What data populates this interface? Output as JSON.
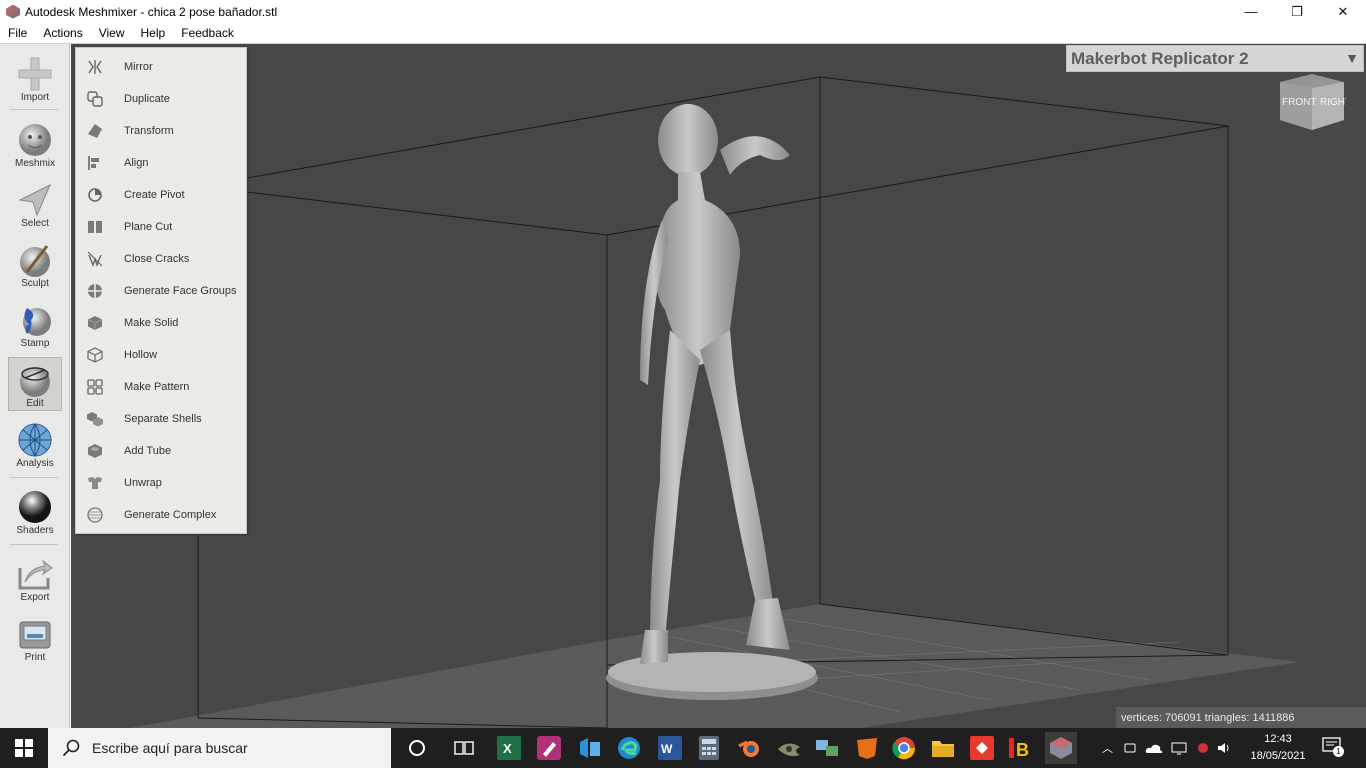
{
  "window": {
    "title": "Autodesk Meshmixer - chica 2 pose bañador.stl",
    "minimize": "—",
    "maximize": "❐",
    "close": "✕"
  },
  "menu": [
    "File",
    "Actions",
    "View",
    "Help",
    "Feedback"
  ],
  "toolbar": [
    {
      "label": "Import",
      "icon": "plus-icon"
    },
    {
      "label": "Meshmix",
      "icon": "face-sphere-icon"
    },
    {
      "label": "Select",
      "icon": "arrow-pointer-icon"
    },
    {
      "label": "Sculpt",
      "icon": "brush-sphere-icon"
    },
    {
      "label": "Stamp",
      "icon": "stamp-sphere-icon"
    },
    {
      "label": "Edit",
      "icon": "edit-sphere-icon"
    },
    {
      "label": "Analysis",
      "icon": "mesh-sphere-icon"
    },
    {
      "label": "Shaders",
      "icon": "chrome-sphere-icon"
    },
    {
      "label": "Export",
      "icon": "export-tray-icon"
    },
    {
      "label": "Print",
      "icon": "printer-icon"
    }
  ],
  "edit_menu": [
    {
      "label": "Mirror",
      "icon": "mirror-icon"
    },
    {
      "label": "Duplicate",
      "icon": "duplicate-icon"
    },
    {
      "label": "Transform",
      "icon": "transform-icon"
    },
    {
      "label": "Align",
      "icon": "align-icon"
    },
    {
      "label": "Create Pivot",
      "icon": "pivot-icon"
    },
    {
      "label": "Plane Cut",
      "icon": "plane-cut-icon"
    },
    {
      "label": "Close Cracks",
      "icon": "close-cracks-icon"
    },
    {
      "label": "Generate Face Groups",
      "icon": "face-groups-icon"
    },
    {
      "label": "Make Solid",
      "icon": "solid-cube-icon"
    },
    {
      "label": "Hollow",
      "icon": "hollow-cube-icon"
    },
    {
      "label": "Make Pattern",
      "icon": "pattern-icon"
    },
    {
      "label": "Separate Shells",
      "icon": "separate-shells-icon"
    },
    {
      "label": "Add Tube",
      "icon": "tube-icon"
    },
    {
      "label": "Unwrap",
      "icon": "unwrap-icon"
    },
    {
      "label": "Generate Complex",
      "icon": "complex-icon"
    }
  ],
  "printer": {
    "name": "Makerbot Replicator 2",
    "arrow": "▼"
  },
  "viewcube": {
    "front": "FRONT",
    "right": "RIGHT"
  },
  "stats": "vertices: 706091 triangles: 1411886",
  "taskbar": {
    "search_placeholder": "Escribe aquí para buscar",
    "time": "12:43",
    "date": "18/05/2021",
    "notification_count": "1"
  },
  "colors": {
    "viewport": "#474747",
    "panel": "#ecebe7",
    "toolbar": "#e9e9e7",
    "taskbar": "#1f1f1f"
  }
}
